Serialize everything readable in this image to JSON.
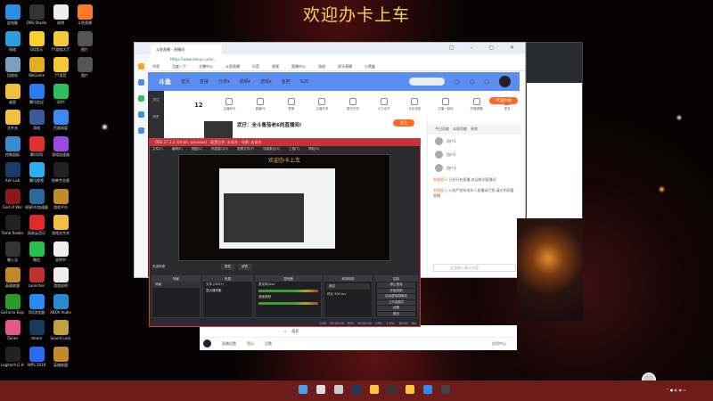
{
  "banner": "欢迎办卡上车",
  "desktop_icons": [
    {
      "label": "此电脑",
      "color": "#2a8fe0"
    },
    {
      "label": "OBS Studio",
      "color": "#333"
    },
    {
      "label": "说明",
      "color": "#eee"
    },
    {
      "label": "斗鱼直播",
      "color": "#ff7a2a"
    },
    {
      "label": "网络",
      "color": "#2a9ee0"
    },
    {
      "label": "QQ音乐",
      "color": "#f5d22a"
    },
    {
      "label": "YY游戏大厅",
      "color": "#f5c83a"
    },
    {
      "label": "图片",
      "color": "#555"
    },
    {
      "label": "回收站",
      "color": "#7aa0c0"
    },
    {
      "label": "WeGame",
      "color": "#e0b020"
    },
    {
      "label": "YY语音",
      "color": "#f5c83a"
    },
    {
      "label": "图片",
      "color": "#555"
    },
    {
      "label": "桌面",
      "color": "#f0c040"
    },
    {
      "label": "腾讯会议",
      "color": "#2a7af0"
    },
    {
      "label": "iQIYI",
      "color": "#2ac060"
    },
    {
      "label": "",
      "color": ""
    },
    {
      "label": "文件夹",
      "color": "#f0c040"
    },
    {
      "label": "游戏",
      "color": "#3a5a9a"
    },
    {
      "label": "百度网盘",
      "color": "#3a8af0"
    },
    {
      "label": "",
      "color": ""
    },
    {
      "label": "控制面板",
      "color": "#3a8ad0"
    },
    {
      "label": "腾讯QQ",
      "color": "#e03030"
    },
    {
      "label": "游戏加速器",
      "color": "#9a4ae0"
    },
    {
      "label": "",
      "color": ""
    },
    {
      "label": "Aim Lab",
      "color": "#1a3a6a"
    },
    {
      "label": "腾讯视频",
      "color": "#2ab0f0"
    },
    {
      "label": "剪映专业版",
      "color": "#222"
    },
    {
      "label": "",
      "color": ""
    },
    {
      "label": "God of War",
      "color": "#8a1a1a"
    },
    {
      "label": "网易UU加速器",
      "color": "#2a6a9a"
    },
    {
      "label": "游戏平台",
      "color": "#c08a2a"
    },
    {
      "label": "",
      "color": ""
    },
    {
      "label": "Tomb Raider",
      "color": "#222"
    },
    {
      "label": "网易云音乐",
      "color": "#e02a2a"
    },
    {
      "label": "游戏文件夹",
      "color": "#f0c040"
    },
    {
      "label": "",
      "color": ""
    },
    {
      "label": "输入法",
      "color": "#333"
    },
    {
      "label": "微信",
      "color": "#2ac050"
    },
    {
      "label": "说明书",
      "color": "#eee"
    },
    {
      "label": "",
      "color": ""
    },
    {
      "label": "英雄联盟",
      "color": "#c08a2a"
    },
    {
      "label": "Launcher",
      "color": "#c03030"
    },
    {
      "label": "游戏说明",
      "color": "#eee"
    },
    {
      "label": "",
      "color": ""
    },
    {
      "label": "GeForce Experience",
      "color": "#2a9a2a"
    },
    {
      "label": "QQ浏览器",
      "color": "#2a8af0"
    },
    {
      "label": "XBOX Audio",
      "color": "#2a8ad0"
    },
    {
      "label": "",
      "color": ""
    },
    {
      "label": "iTunes",
      "color": "#e05a8a"
    },
    {
      "label": "steam",
      "color": "#1a3a5a"
    },
    {
      "label": "Sound Lock",
      "color": "#c0a040"
    },
    {
      "label": "",
      "color": ""
    },
    {
      "label": "Logitech G HUB",
      "color": "#222"
    },
    {
      "label": "WPS 2019",
      "color": "#2a6af0"
    },
    {
      "label": "英雄联盟",
      "color": "#c08a2a"
    },
    {
      "label": "",
      "color": ""
    }
  ],
  "browser": {
    "tab": "斗鱼直播 - 直播间",
    "url": "https://www.douyu.com/...",
    "bookmarks": [
      "书签",
      "百度一下",
      "主播中心",
      "斗鱼直播",
      "抖音",
      "视频",
      "直播中心",
      "游戏",
      "虎牙直播",
      "小黑盒"
    ],
    "nav": {
      "logo": "斗鱼",
      "items": [
        "首页",
        "直播",
        "分类▾",
        "视频▾",
        "游戏▾",
        "鱼吧",
        "520"
      ]
    },
    "sidebar": [
      "关注",
      "历史"
    ],
    "tools": [
      "主播积分",
      "直播PK",
      "表情",
      "主播任务",
      "星光任务",
      "火力全开",
      "分区特权",
      "主播一起玩",
      "开播提醒",
      "更多"
    ],
    "score": "12",
    "stream_title": "武仔：全斗鲁茄老6的直播间!",
    "follow": "关注",
    "pc_client": "PC客户端",
    "chat": {
      "tabs": [
        "今日贡献",
        "本周贡献",
        "贵宾"
      ],
      "users": [
        "用户1",
        "用户2",
        "用户3"
      ],
      "messages": [
        {
          "tag": "系统提示:",
          "text": "已经开启直播,欢迎来到直播间"
        },
        {
          "tag": "系统提示:",
          "text": "斗鱼严禁未成年人直播或打赏,请文明观看直播"
        }
      ],
      "input_placeholder": "这里输入聊天内容"
    }
  },
  "livebar": {
    "search": "搜索",
    "items": [
      "直播设置",
      "音乐",
      "设置"
    ],
    "app_center": "应用中心"
  },
  "obs": {
    "title": "OBS 27.2.3 (64-bit, windows) - 配置文件: 未命名 - 场景: 未命名",
    "menu": [
      "文件(F)",
      "编辑(E)",
      "视图(V)",
      "停靠窗口(D)",
      "配置文件(P)",
      "场景集合(S)",
      "工具(T)",
      "帮助(H)"
    ],
    "preview_text": "欢迎办卡上车",
    "no_source": "未选择源",
    "props": "属性",
    "filters": "滤镜",
    "docks": {
      "scenes": "场景",
      "sources": "来源",
      "mixer": "混音器",
      "transitions": "转场特效",
      "controls": "控制"
    },
    "scene_items": [
      "场景"
    ],
    "source_items": [
      "文本 (GDI+)",
      "显示器采集"
    ],
    "mixer_items": [
      "麦克风/Aux",
      "桌面音频"
    ],
    "transition": "渐变",
    "duration_label": "时长",
    "duration": "300 ms",
    "control_buttons": [
      "停止推流",
      "开始录制",
      "启动虚拟摄像机",
      "工作室模式",
      "设置",
      "退出"
    ],
    "status": "LIVE 00:00:00  REC 00:00:00  CPU: 1.0%, 60.00 fps"
  },
  "taskbar": {
    "icons": [
      "start",
      "search",
      "task-view",
      "steam",
      "yy",
      "obs",
      "yy-voice",
      "browser",
      "douyu"
    ]
  }
}
